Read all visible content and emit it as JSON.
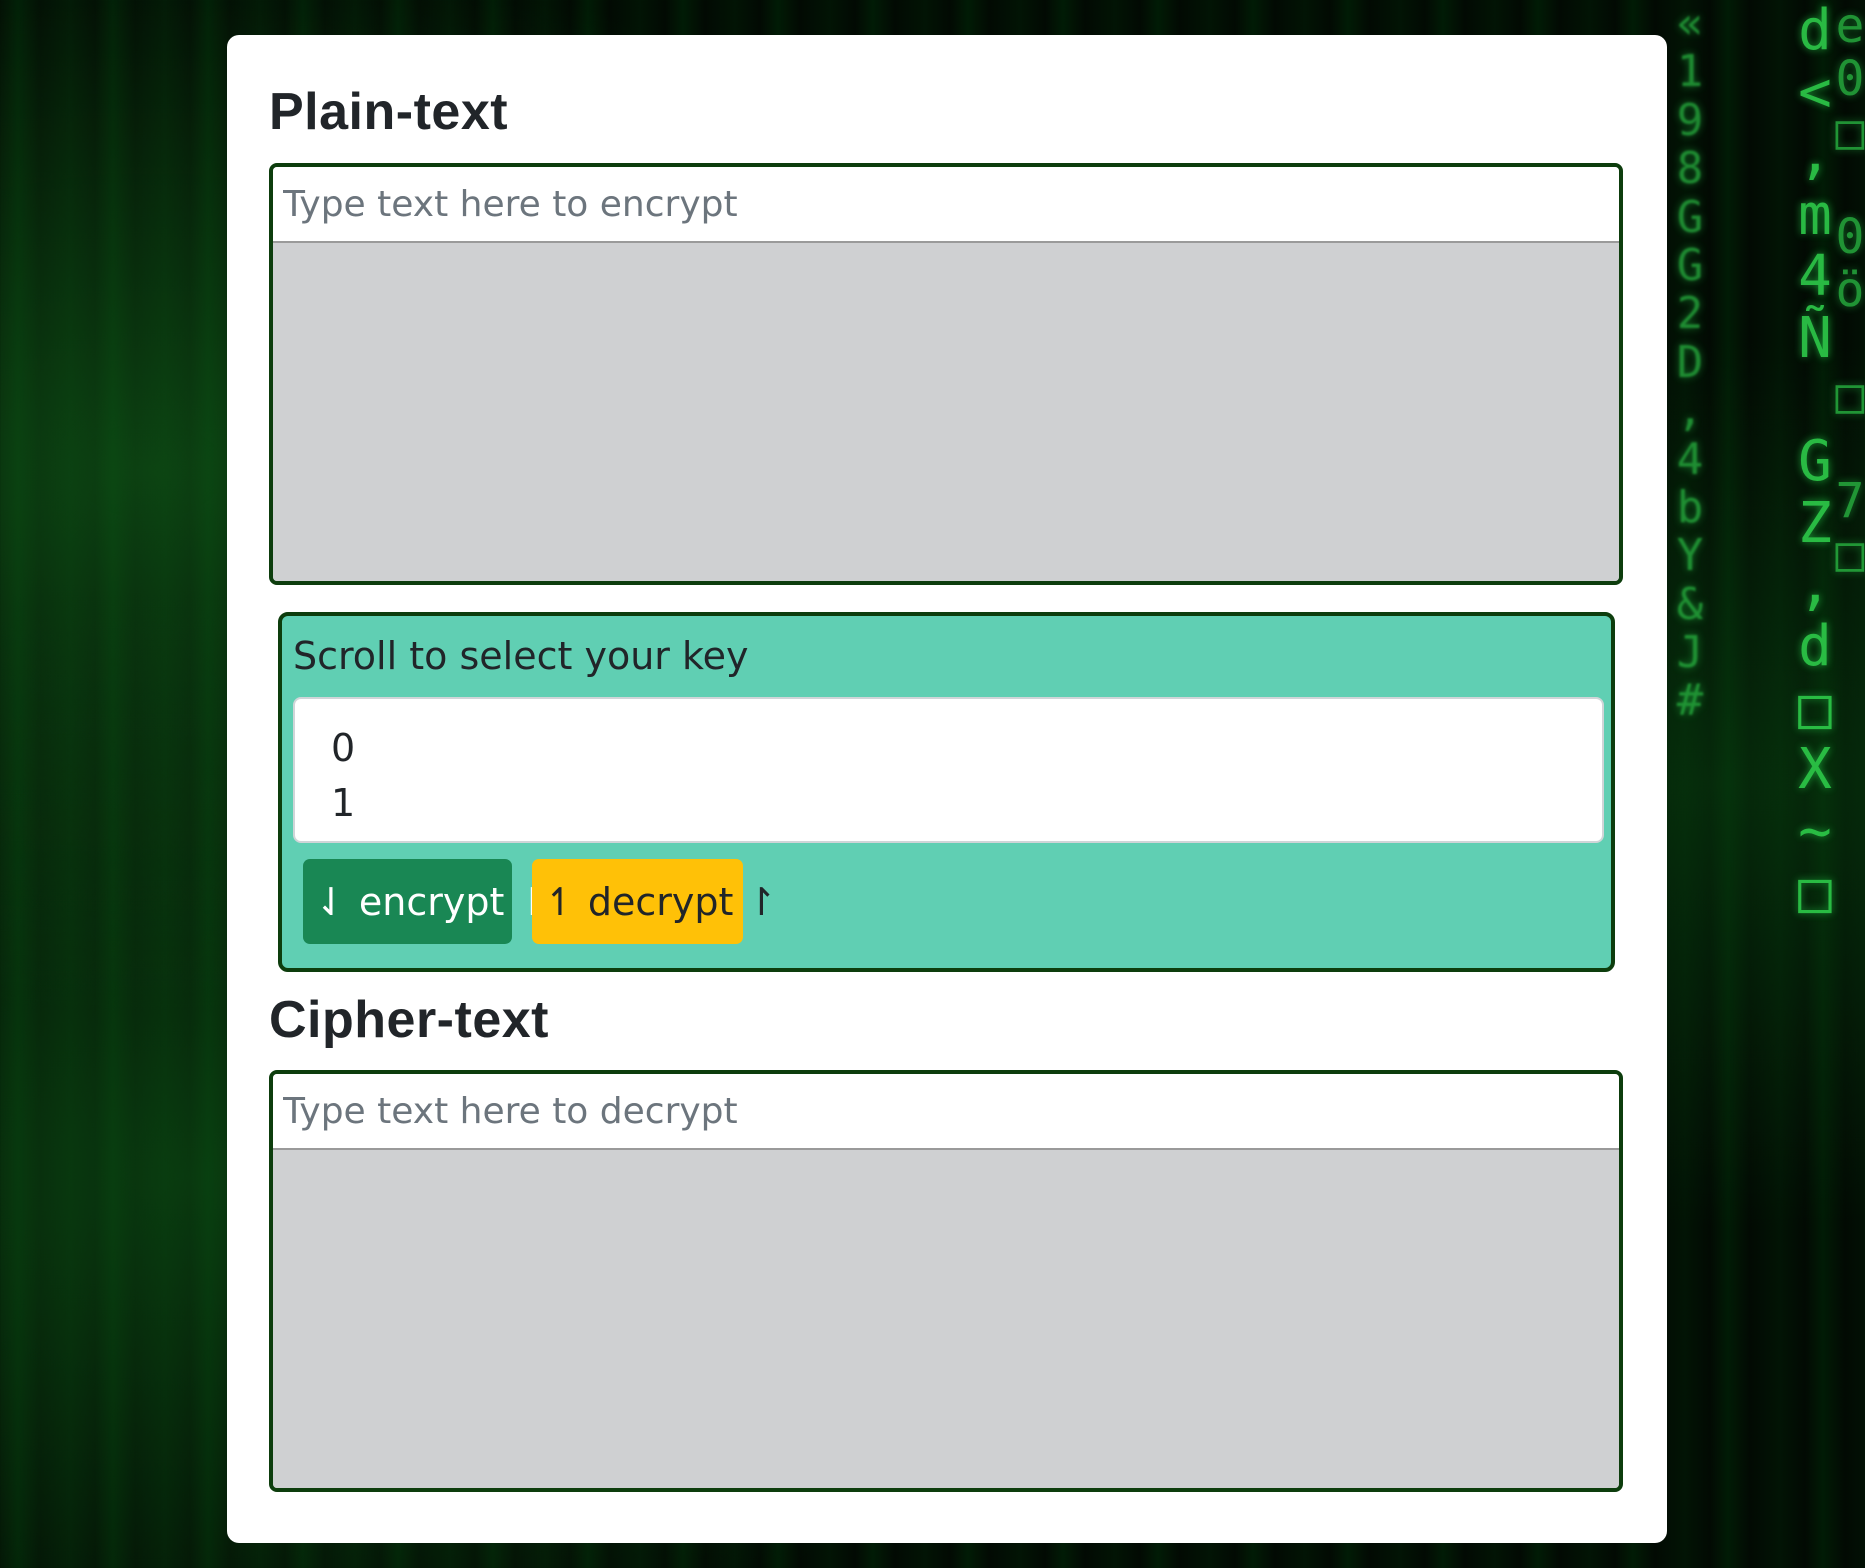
{
  "background": {
    "rain_col_1": "«\n1\n9\n8\nG\nG\n2\nD\n,\n4\nb\nY\n&\nJ\n#",
    "rain_col_2": "d\n<\n,\nm\n4\nÑ\n \nG\nZ\n,\nd\n□\nX\n~\n□",
    "rain_col_3": "e\n0\n□\n \n0\nö\n \n□\n \n7\n□"
  },
  "plain": {
    "heading": "Plain-text",
    "placeholder": "Type text here to encrypt"
  },
  "key": {
    "label": "Scroll to select your key",
    "options": [
      "0",
      "1"
    ],
    "encrypt_label": "⇃ encrypt ⇂",
    "decrypt_label": "↿ decrypt ↾"
  },
  "cipher": {
    "heading": "Cipher-text",
    "placeholder": "Type text here to decrypt"
  },
  "colors": {
    "card": "#ffffff",
    "panel": "#60cfb3",
    "border": "#0d3d0d",
    "encrypt_button": "#198754",
    "decrypt_button": "#ffc107",
    "textarea": "#cfd0d2"
  }
}
